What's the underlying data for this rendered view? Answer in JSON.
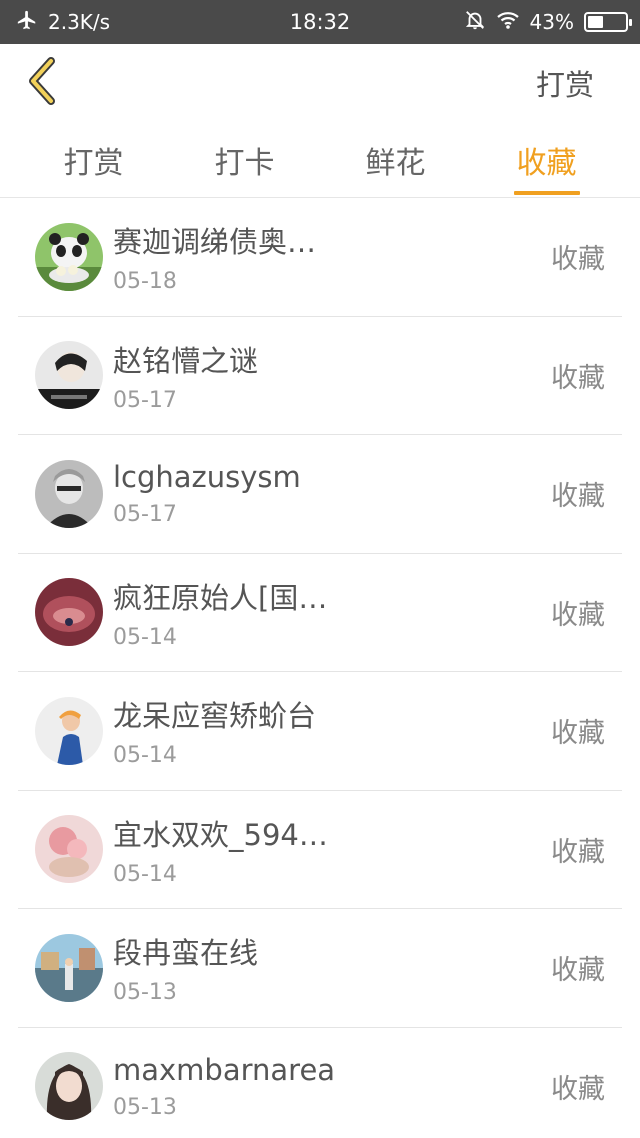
{
  "status_bar": {
    "speed": "2.3K/s",
    "time": "18:32",
    "battery": "43%",
    "battery_level": 0.43,
    "icons": [
      "airplane-icon",
      "mute-bell-icon",
      "wifi-icon",
      "battery-icon"
    ]
  },
  "header": {
    "action_label": "打赏",
    "accent_color": "#f0a020"
  },
  "tabs": [
    {
      "label": "打赏",
      "active": false
    },
    {
      "label": "打卡",
      "active": false
    },
    {
      "label": "鲜花",
      "active": false
    },
    {
      "label": "收藏",
      "active": true
    }
  ],
  "items": [
    {
      "name": "赛迦调绨债奥…",
      "date": "05-18",
      "action": "收藏"
    },
    {
      "name": "赵铭懵之谜",
      "date": "05-17",
      "action": "收藏"
    },
    {
      "name": "lcghazusysm",
      "date": "05-17",
      "action": "收藏"
    },
    {
      "name": "疯狂原始人[国…",
      "date": "05-14",
      "action": "收藏"
    },
    {
      "name": "龙呆应窖矫蚧台",
      "date": "05-14",
      "action": "收藏"
    },
    {
      "name": "宜水双欢_594…",
      "date": "05-14",
      "action": "收藏"
    },
    {
      "name": "段冉蛮在线",
      "date": "05-13",
      "action": "收藏"
    },
    {
      "name": "maxmbarnarea",
      "date": "05-13",
      "action": "收藏"
    }
  ]
}
